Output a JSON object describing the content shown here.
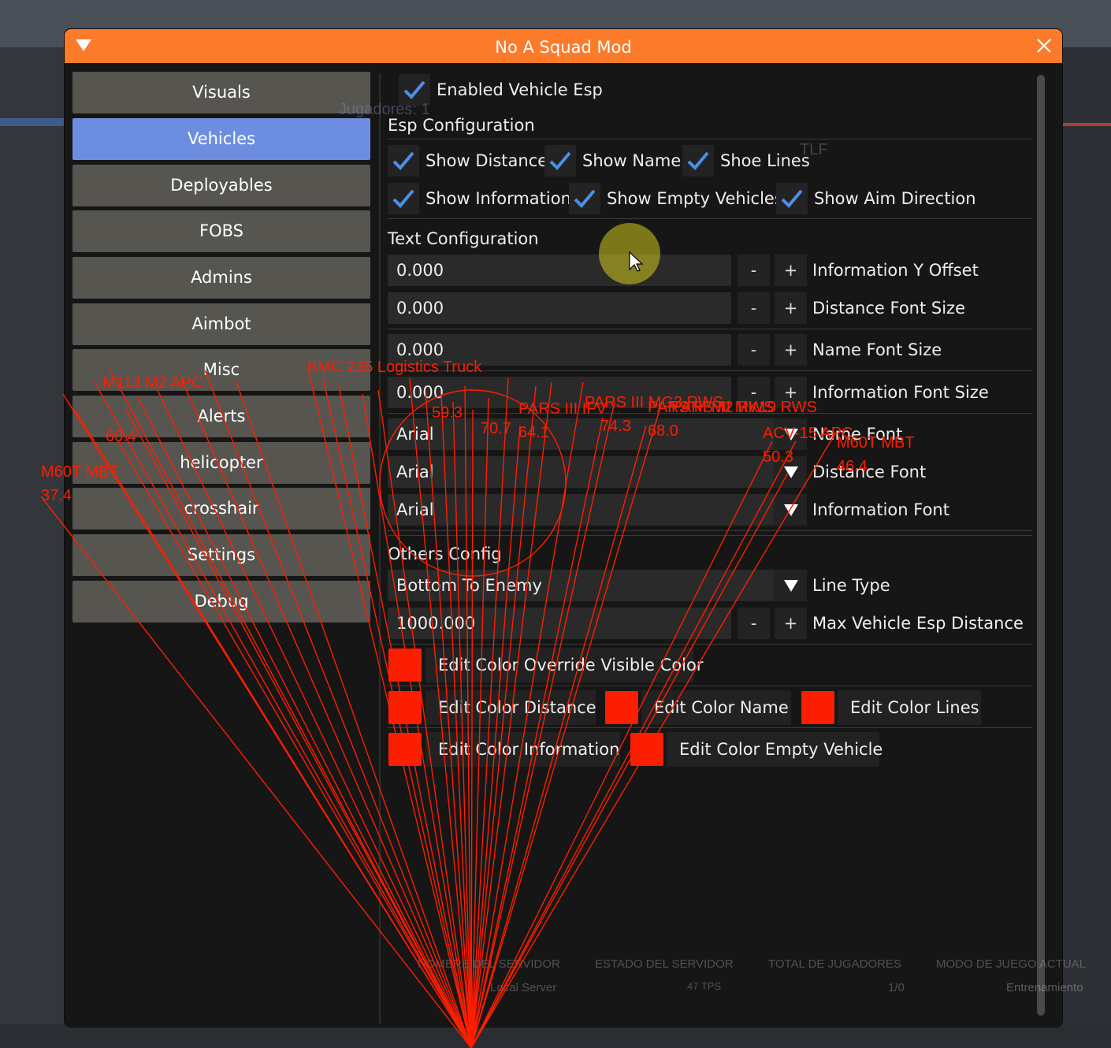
{
  "window": {
    "title": "No A Squad Mod"
  },
  "sidebar": {
    "items": [
      {
        "label": "Visuals"
      },
      {
        "label": "Vehicles"
      },
      {
        "label": "Deployables"
      },
      {
        "label": "FOBS"
      },
      {
        "label": "Admins"
      },
      {
        "label": "Aimbot"
      },
      {
        "label": "Misc"
      },
      {
        "label": "Alerts"
      },
      {
        "label": "helicopter"
      },
      {
        "label": "crosshair"
      },
      {
        "label": "Settings"
      },
      {
        "label": "Debug"
      }
    ],
    "active_index": 1
  },
  "vehicles": {
    "enabled": {
      "label": "Enabled Vehicle Esp",
      "checked": true
    },
    "esp_section": "Esp Configuration",
    "esp_options": [
      {
        "label": "Show Distance",
        "checked": true
      },
      {
        "label": "Show Name",
        "checked": true
      },
      {
        "label": "Shoe Lines",
        "checked": true
      },
      {
        "label": "Show Information",
        "checked": true
      },
      {
        "label": "Show Empty Vehicles",
        "checked": true
      },
      {
        "label": "Show Aim Direction",
        "checked": true
      }
    ],
    "text_section": "Text Configuration",
    "numeric_fields": [
      {
        "value": "0.000",
        "label": "Information Y Offset"
      },
      {
        "value": "0.000",
        "label": "Distance Font Size"
      },
      {
        "value": "0.000",
        "label": "Name Font Size"
      },
      {
        "value": "0.000",
        "label": "Information Font Size"
      }
    ],
    "stepper": {
      "minus": "-",
      "plus": "+"
    },
    "font_combos": [
      {
        "value": "Arial",
        "label": "Name Font"
      },
      {
        "value": "Arial",
        "label": "Distance Font"
      },
      {
        "value": "Arial",
        "label": "Information Font"
      }
    ],
    "others_section": "Others Config",
    "line_type": {
      "value": "Bottom To Enemy",
      "label": "Line Type"
    },
    "max_distance": {
      "value": "1000.000",
      "label": "Max Vehicle Esp Distance"
    },
    "colors": [
      {
        "label": "Edit Color Override Visible Color"
      },
      {
        "label": "Edit Color Distance"
      },
      {
        "label": "Edit Color Name"
      },
      {
        "label": "Edit Color Lines"
      },
      {
        "label": "Edit Color Information"
      },
      {
        "label": "Edit Color Empty Vehicle"
      }
    ],
    "swatch_color": "#fc1e00",
    "check_color": "#4a90e8"
  },
  "esp_overlay": {
    "color": "#ff1e00",
    "labels": [
      {
        "name": "M60T MBT",
        "dist": "37.4"
      },
      {
        "name": "ACV-15 APC",
        "dist": "50.3"
      },
      {
        "name": "M60T MBT",
        "dist": "46.4"
      },
      {
        "name": "PARS III IFV",
        "dist": "64.1"
      },
      {
        "name": "PARS III MG3 RWS",
        "dist": "74.3"
      },
      {
        "name": "PARS III M2 RWS",
        "dist": "68.0"
      },
      {
        "name": "PARS III MK19 RWS",
        "dist": "70.7"
      },
      {
        "name": "BMC 235 Logistics Truck",
        "dist": "59.3"
      },
      {
        "name": "M113 M2 APC",
        "dist": "60.4"
      }
    ]
  },
  "background_status": {
    "headers": [
      "NOMBRE DEL SERVIDOR",
      "ESTADO DEL SERVIDOR",
      "TOTAL DE JUGADORES",
      "MODO DE JUEGO ACTUAL"
    ],
    "values": [
      "Local Server",
      "47 TPS",
      "1/0",
      "Entrenamiento"
    ],
    "flag_text": "TLF",
    "top_text": "Jugadores: 1"
  }
}
